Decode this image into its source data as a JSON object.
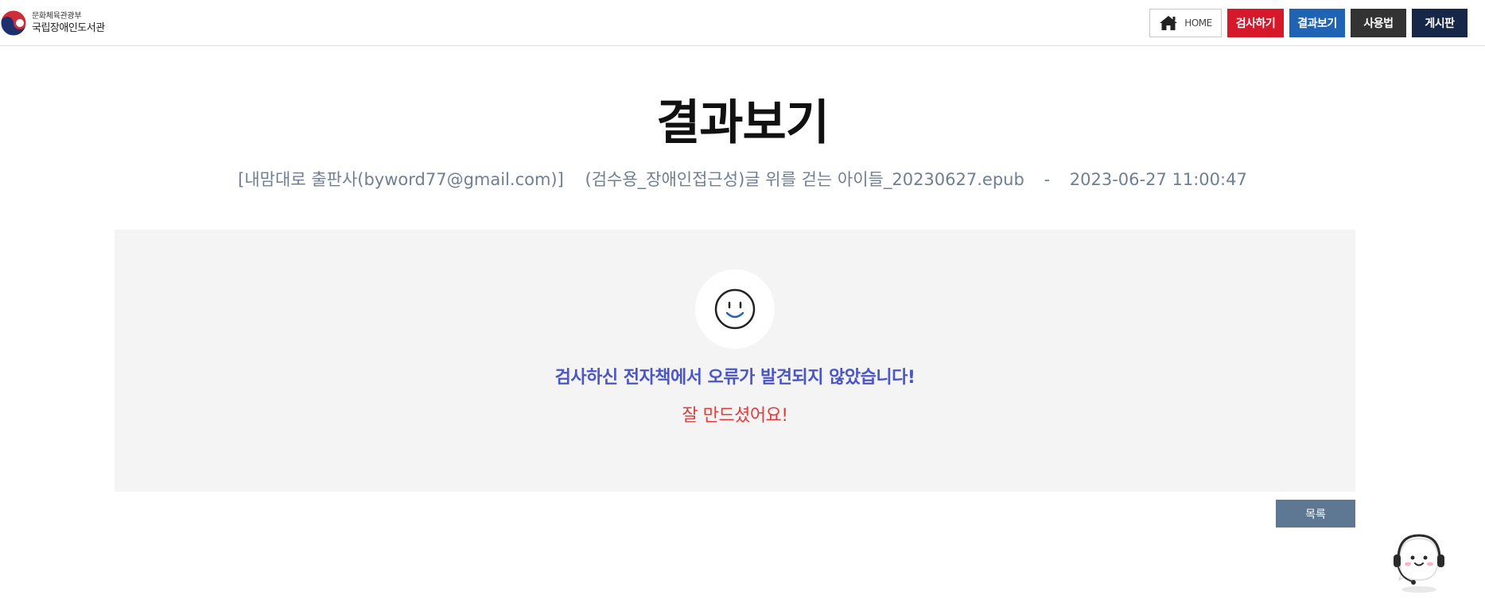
{
  "header": {
    "logo": {
      "ministry": "문화체육관광부",
      "library": "국립장애인도서관"
    },
    "nav": {
      "home_label": "HOME",
      "check_label": "검사하기",
      "result_label": "결과보기",
      "usage_label": "사용법",
      "board_label": "게시판"
    }
  },
  "main": {
    "title": "결과보기",
    "file_info": {
      "publisher": "[내맘대로 출판사(byword77@gmail.com)]",
      "filename": "(검수용_장애인접근성)글 위를 걷는 아이들_20230627.epub",
      "separator": "-",
      "datetime": "2023-06-27 11:00:47"
    },
    "result": {
      "message": "검사하신 전자책에서 오류가 발견되지 않았습니다!",
      "sub_message": "잘 만드셨어요!"
    },
    "list_button_label": "목록"
  },
  "colors": {
    "check": "#d7182a",
    "result": "#1f64b4",
    "usage": "#333333",
    "board": "#16274a",
    "message": "#4a55c9",
    "sub_message": "#e53b3b",
    "list_button": "#5e7894"
  },
  "icons": [
    "taegeuk-emblem-icon",
    "home-icon",
    "smiley-icon",
    "chatbot-icon"
  ]
}
